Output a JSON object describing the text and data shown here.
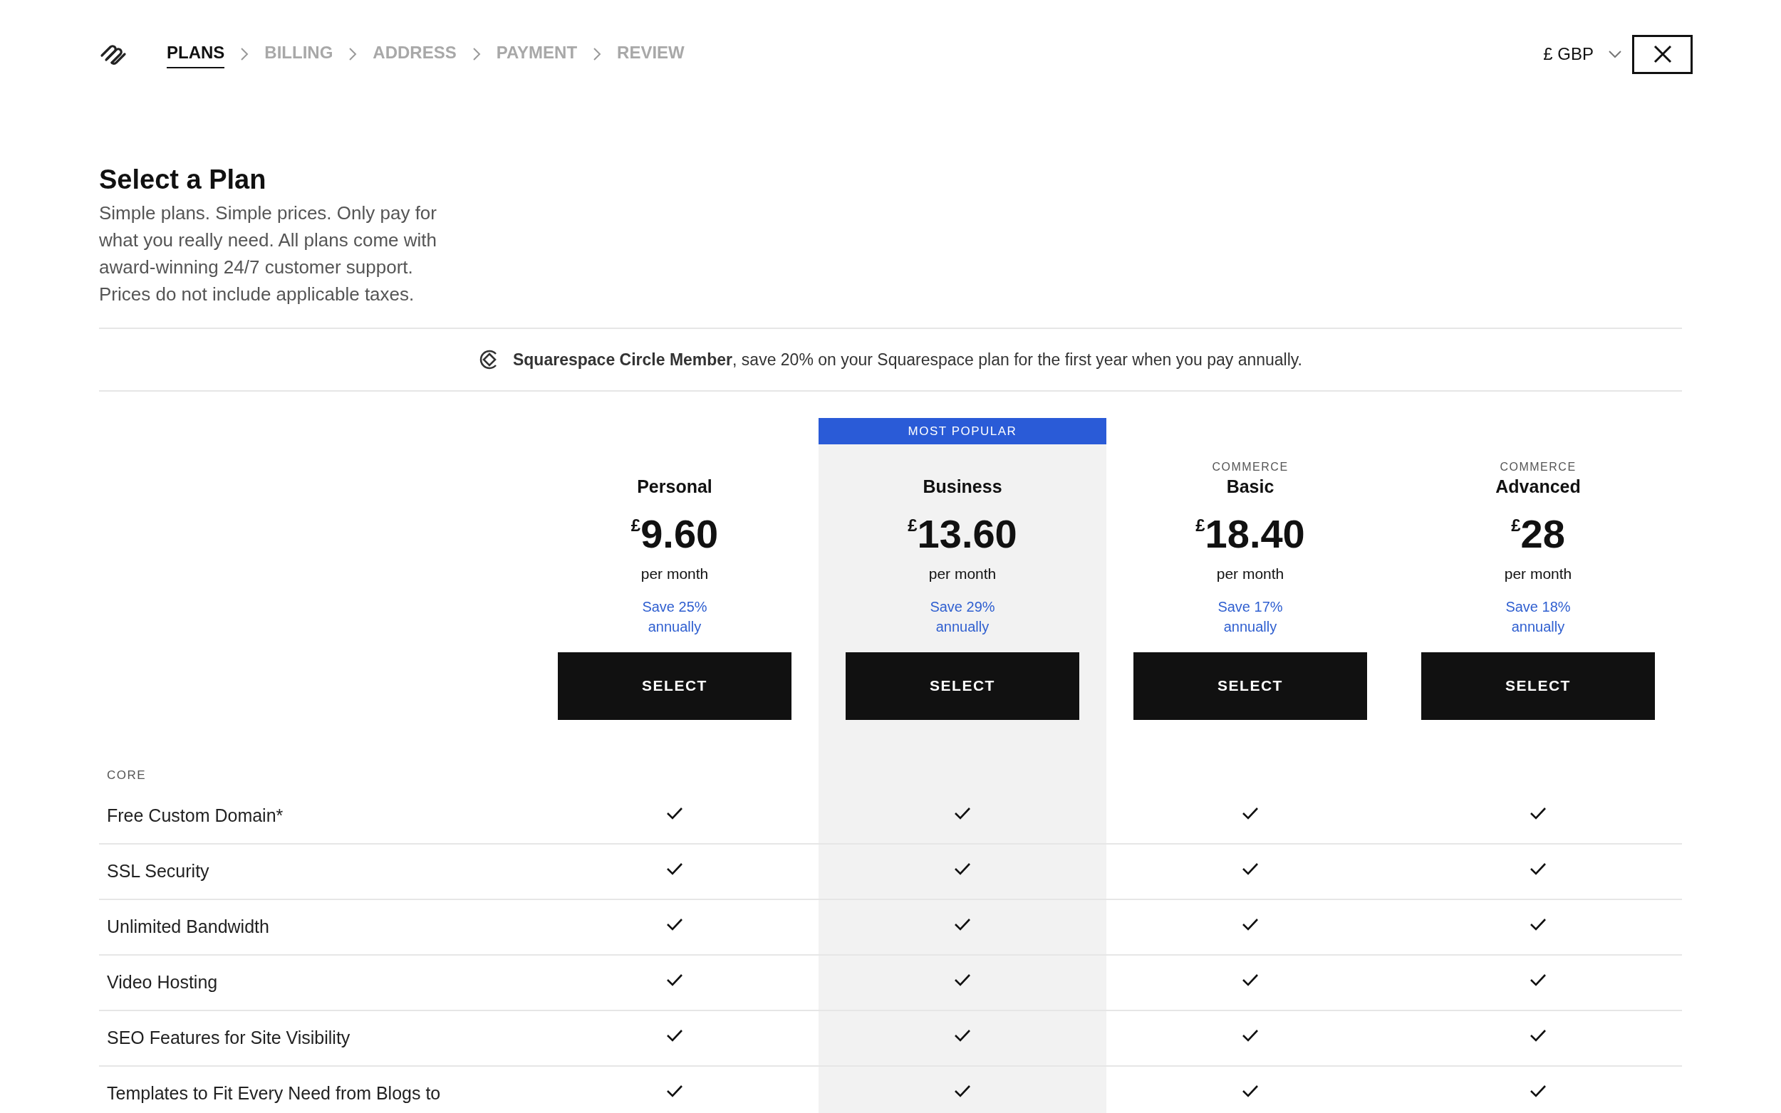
{
  "nav": {
    "steps": [
      {
        "label": "PLANS",
        "selected": true
      },
      {
        "label": "BILLING",
        "selected": false
      },
      {
        "label": "ADDRESS",
        "selected": false
      },
      {
        "label": "PAYMENT",
        "selected": false
      },
      {
        "label": "REVIEW",
        "selected": false
      }
    ]
  },
  "currency": {
    "label": "£ GBP"
  },
  "intro": {
    "title": "Select a Plan",
    "description": "Simple plans. Simple prices. Only pay for what you really need. All plans come with award-winning 24/7 customer support. Prices do not include applicable taxes."
  },
  "banner": {
    "text": "**Squarespace Circle Member**, save 20% on your Squarespace plan for the first year when you pay annually."
  },
  "plans": [
    {
      "featured": false,
      "name": "Personal",
      "currency": "£",
      "price": "9.60",
      "period": "per month",
      "savings": "Save 25% annually",
      "button": "SELECT"
    },
    {
      "featured": true,
      "badge": "MOST POPULAR",
      "name": "Business",
      "currency": "£",
      "price": "13.60",
      "period": "per month",
      "savings": "Save 29% annually",
      "button": "SELECT"
    },
    {
      "featured": false,
      "kicker": "COMMERCE",
      "name": "Basic",
      "currency": "£",
      "price": "18.40",
      "period": "per month",
      "savings": "Save 17% annually",
      "button": "SELECT"
    },
    {
      "featured": false,
      "kicker": "COMMERCE",
      "name": "Advanced",
      "currency": "£",
      "price": "28",
      "period": "per month",
      "savings": "Save 18% annually",
      "button": "SELECT"
    }
  ],
  "features": {
    "section": "CORE",
    "rows": [
      {
        "label": "Free Custom Domain*",
        "included": [
          true,
          true,
          true,
          true
        ]
      },
      {
        "label": "SSL Security",
        "included": [
          true,
          true,
          true,
          true
        ]
      },
      {
        "label": "Unlimited Bandwidth",
        "included": [
          true,
          true,
          true,
          true
        ]
      },
      {
        "label": "Video Hosting",
        "included": [
          true,
          true,
          true,
          true
        ]
      },
      {
        "label": "SEO Features for Site Visibility",
        "included": [
          true,
          true,
          true,
          true
        ]
      },
      {
        "label": "Templates to Fit Every Need from Blogs to",
        "included": [
          true,
          true,
          true,
          true
        ]
      }
    ]
  }
}
